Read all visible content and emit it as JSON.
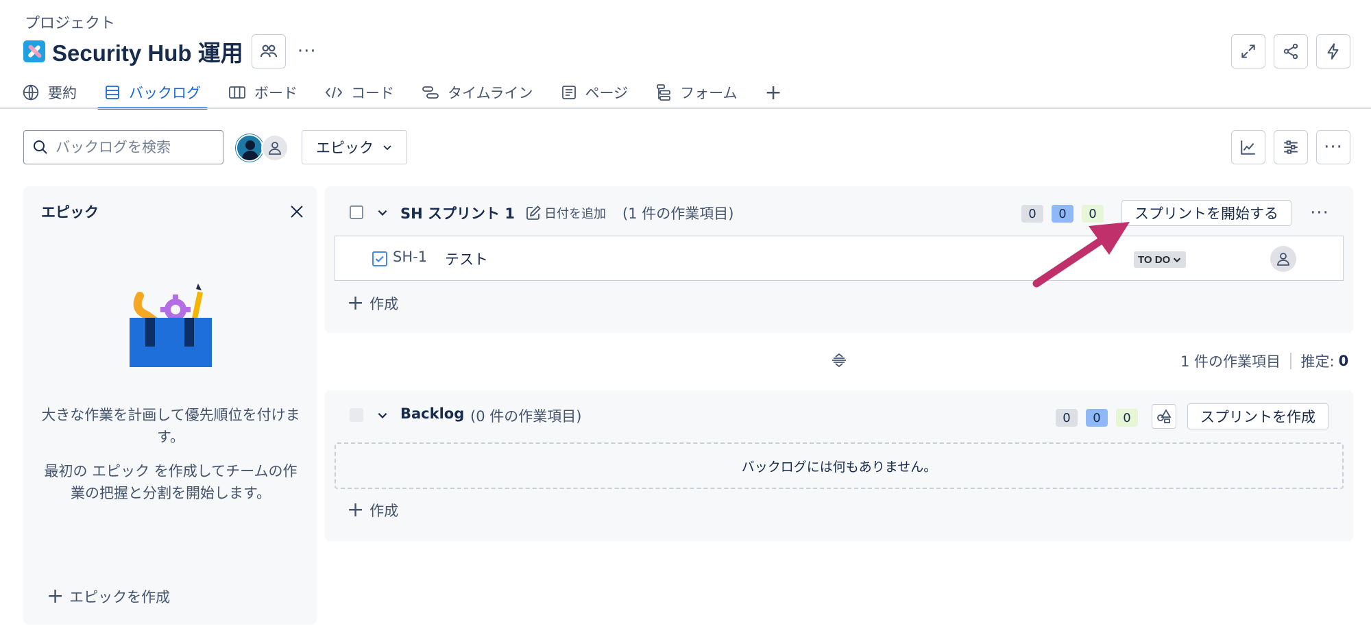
{
  "header": {
    "breadcrumb": "プロジェクト",
    "project_title": "Security Hub 運用"
  },
  "tabs": [
    {
      "label": "要約",
      "icon": "globe-icon"
    },
    {
      "label": "バックログ",
      "icon": "list-icon",
      "active": true
    },
    {
      "label": "ボード",
      "icon": "board-icon"
    },
    {
      "label": "コード",
      "icon": "code-icon"
    },
    {
      "label": "タイムライン",
      "icon": "timeline-icon"
    },
    {
      "label": "ページ",
      "icon": "page-icon"
    },
    {
      "label": "フォーム",
      "icon": "form-icon"
    }
  ],
  "toolbar": {
    "search_placeholder": "バックログを検索",
    "epic_filter_label": "エピック"
  },
  "epic_panel": {
    "title": "エピック",
    "description_1": "大きな作業を計画して優先順位を付けます。",
    "description_2": "最初の エピック を作成してチームの作業の把握と分割を開始します。",
    "create_label": "エピックを作成"
  },
  "sprint": {
    "name": "SH スプリント 1",
    "add_date_label": "日付を追加",
    "count_text": "(1 件の作業項目)",
    "counts": {
      "todo": "0",
      "in_progress": "0",
      "done": "0"
    },
    "start_button_label": "スプリントを開始する",
    "issues": [
      {
        "key": "SH-1",
        "summary": "テスト",
        "status": "TO DO"
      }
    ],
    "create_label": "作成"
  },
  "summary": {
    "item_count_text": "1 件の作業項目",
    "estimate_label": "推定:",
    "estimate_value": "0"
  },
  "backlog": {
    "name": "Backlog",
    "count_text": "(0 件の作業項目)",
    "counts": {
      "todo": "0",
      "in_progress": "0",
      "done": "0"
    },
    "create_sprint_label": "スプリントを作成",
    "empty_text": "バックログには何もありません。",
    "create_label": "作成"
  },
  "colors": {
    "accent": "#1868db",
    "arrow": "#c0306a"
  }
}
